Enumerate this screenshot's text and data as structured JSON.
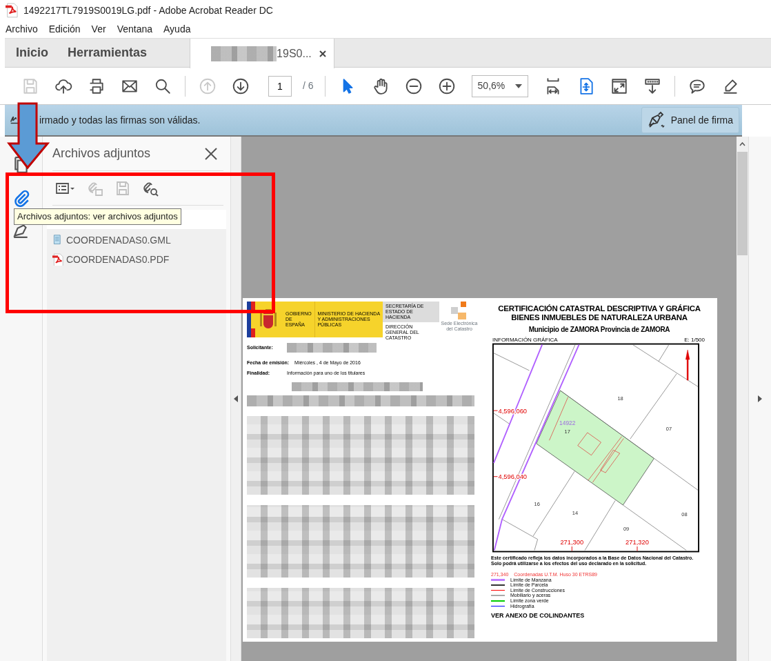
{
  "window": {
    "title": "1492217TL7919S0019LG.pdf - Adobe Acrobat Reader DC"
  },
  "menu": [
    "Archivo",
    "Edición",
    "Ver",
    "Ventana",
    "Ayuda"
  ],
  "tabs": [
    {
      "label": "Inicio",
      "selected": false,
      "kind": "home"
    },
    {
      "label": "Herramientas",
      "selected": false,
      "kind": "home"
    },
    {
      "label": "19S0...",
      "selected": true,
      "kind": "document"
    }
  ],
  "toolbar": {
    "groups": [
      {
        "tools": [
          {
            "kind": "save",
            "disabled": true,
            "selected": false
          },
          {
            "kind": "upload",
            "disabled": false,
            "selected": false
          },
          {
            "kind": "print",
            "disabled": false,
            "selected": false
          },
          {
            "kind": "mail",
            "disabled": false,
            "selected": false
          },
          {
            "kind": "search",
            "disabled": false,
            "selected": false
          }
        ]
      },
      {
        "tools": [
          {
            "kind": "prev",
            "disabled": true,
            "selected": false
          },
          {
            "kind": "next",
            "disabled": false,
            "selected": false
          },
          {
            "kind": "page_field",
            "value": "1",
            "total": "/ 6"
          }
        ]
      },
      {
        "tools": [
          {
            "kind": "select",
            "disabled": false,
            "selected": true
          },
          {
            "kind": "hand",
            "disabled": false,
            "selected": false
          },
          {
            "kind": "zoom_out",
            "disabled": false,
            "selected": false
          },
          {
            "kind": "zoom_in",
            "disabled": false,
            "selected": false
          },
          {
            "kind": "zoom_select",
            "value": "50,6%"
          },
          {
            "kind": "fit_width",
            "disabled": false,
            "selected": false
          },
          {
            "kind": "fit_page",
            "disabled": false,
            "selected": true
          },
          {
            "kind": "fullscreen",
            "disabled": false,
            "selected": false
          },
          {
            "kind": "read",
            "disabled": false,
            "selected": false
          }
        ]
      },
      {
        "tools": [
          {
            "kind": "comment",
            "disabled": false,
            "selected": false
          },
          {
            "kind": "highlight",
            "disabled": false,
            "selected": false
          }
        ]
      }
    ]
  },
  "signature_bar": {
    "message": "irmado y todas las firmas son válidas.",
    "button": "Panel de firma"
  },
  "side_icons": [
    {
      "kind": "pages",
      "selected": false
    },
    {
      "kind": "attachments",
      "selected": true
    },
    {
      "kind": "signatures",
      "selected": false
    }
  ],
  "attachments_panel": {
    "title": "Archivos adjuntos",
    "tools": [
      {
        "kind": "options",
        "disabled": false
      },
      {
        "kind": "add",
        "disabled": true
      },
      {
        "kind": "save",
        "disabled": true
      },
      {
        "kind": "find",
        "disabled": false
      }
    ],
    "files": [
      {
        "name": "COORDENADAS0.GML",
        "kind": "gml"
      },
      {
        "name": "COORDENADAS0.PDF",
        "kind": "pdf"
      }
    ]
  },
  "tooltip": "Archivos adjuntos: ver archivos adjuntos",
  "document": {
    "logos": {
      "government": "GOBIERNO DE ESPAÑA",
      "ministry": "MINISTERIO DE HACIENDA Y ADMINISTRACIONES PÚBLICAS",
      "secretariat": "SECRETARÍA DE ESTADO DE HACIENDA",
      "directorate": "DIRECCIÓN GENERAL DEL CATASTRO",
      "site": "Sede Electrónica del Catastro"
    },
    "titles": [
      "CERTIFICACIÓN CATASTRAL DESCRIPTIVA Y GRÁFICA",
      "BIENES INMUEBLES DE NATURALEZA URBANA"
    ],
    "subtitle": "Municipio de ZAMORA Provincia de ZAMORA",
    "fields": [
      {
        "label": "Solicitante:",
        "redacted": true
      },
      {
        "label": "Fecha de emisión:",
        "value": "Miércoles , 4 de Mayo de 2016",
        "redacted": false
      },
      {
        "label": "Finalidad:",
        "value": "Información para uno de los titulares",
        "redacted": false
      }
    ],
    "map": {
      "title": "INFORMACIÓN GRÁFICA",
      "scale": "E: 1/500",
      "parcels": [
        "18",
        "07",
        "17",
        "16",
        "14",
        "09",
        "08"
      ],
      "plot": "14922",
      "y_coords": [
        "4,596,060",
        "4,596,040"
      ],
      "x_coords": [
        "271,300",
        "271,320"
      ]
    },
    "note": "Este certificado refleja los datos incorporados a la Base de Datos Nacional del Catastro. Solo podrá utilizarse a los efectos del uso declarado en la solicitud.",
    "legend_head": {
      "code": "271,340",
      "label": "Coordenadas U.T.M. Huso 30 ETRS89"
    },
    "legend": [
      {
        "label": "Límite de Manzana",
        "color": "#c080ff"
      },
      {
        "label": "Límite de Parcela",
        "color": "#333333"
      },
      {
        "label": "Límite de Construcciones",
        "color": "#ff0000"
      },
      {
        "label": "Mobiliario y aceras",
        "color": "#aaaaaa"
      },
      {
        "label": "Límite zona verde",
        "color": "#00cc00"
      },
      {
        "label": "Hidrografía",
        "color": "#0000ff"
      }
    ],
    "annex": "VER ANEXO DE COLINDANTES"
  }
}
